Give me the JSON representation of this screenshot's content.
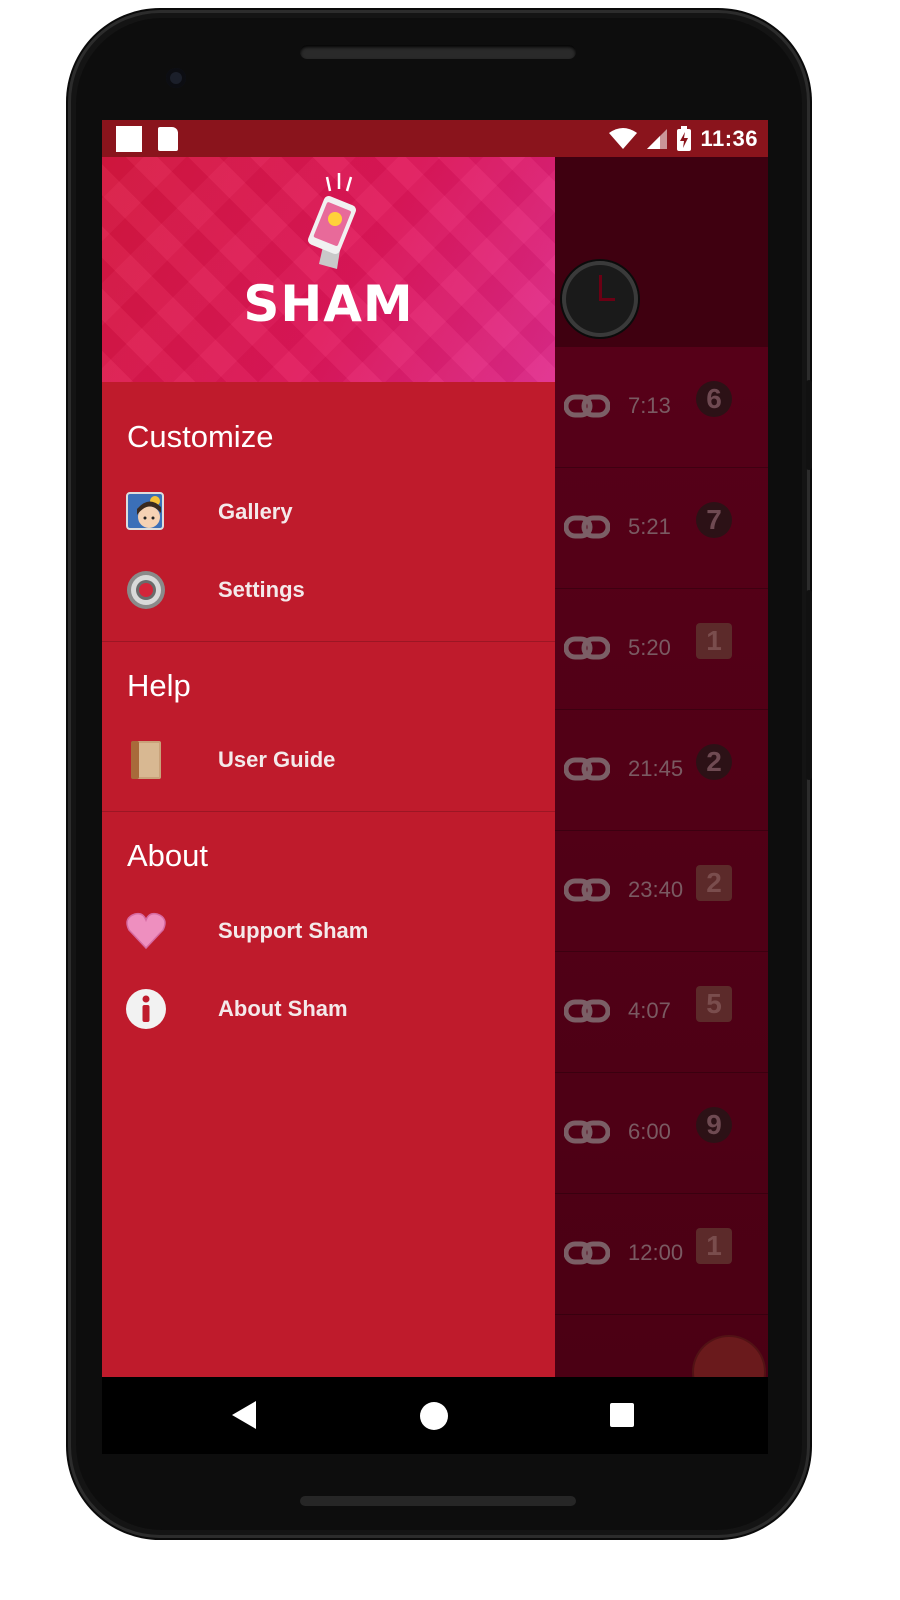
{
  "status_bar": {
    "time": "11:36"
  },
  "drawer": {
    "logo_text": "SHAM",
    "sections": [
      {
        "title": "Customize",
        "items": [
          {
            "label": "Gallery",
            "icon": "gallery-icon"
          },
          {
            "label": "Settings",
            "icon": "settings-icon"
          }
        ]
      },
      {
        "title": "Help",
        "items": [
          {
            "label": "User Guide",
            "icon": "book-icon"
          }
        ]
      },
      {
        "title": "About",
        "items": [
          {
            "label": "Support Sham",
            "icon": "heart-icon"
          },
          {
            "label": "About Sham",
            "icon": "info-icon"
          }
        ]
      }
    ]
  },
  "background_list": {
    "rows": [
      {
        "time": "7:13",
        "badge": "6",
        "badge_shape": "circle"
      },
      {
        "time": "5:21",
        "badge": "7",
        "badge_shape": "circle"
      },
      {
        "time": "5:20",
        "badge": "1",
        "badge_shape": "cube"
      },
      {
        "time": "21:45",
        "badge": "2",
        "badge_shape": "circle"
      },
      {
        "time": "23:40",
        "badge": "2",
        "badge_shape": "cube"
      },
      {
        "time": "4:07",
        "badge": "5",
        "badge_shape": "cube"
      },
      {
        "time": "6:00",
        "badge": "9",
        "badge_shape": "circle"
      },
      {
        "time": "12:00",
        "badge": "1",
        "badge_shape": "cube"
      }
    ]
  },
  "colors": {
    "status_bar": "#8a141c",
    "drawer": "#bf1b2c",
    "header_start": "#d8173f",
    "header_end": "#e02a8c"
  }
}
